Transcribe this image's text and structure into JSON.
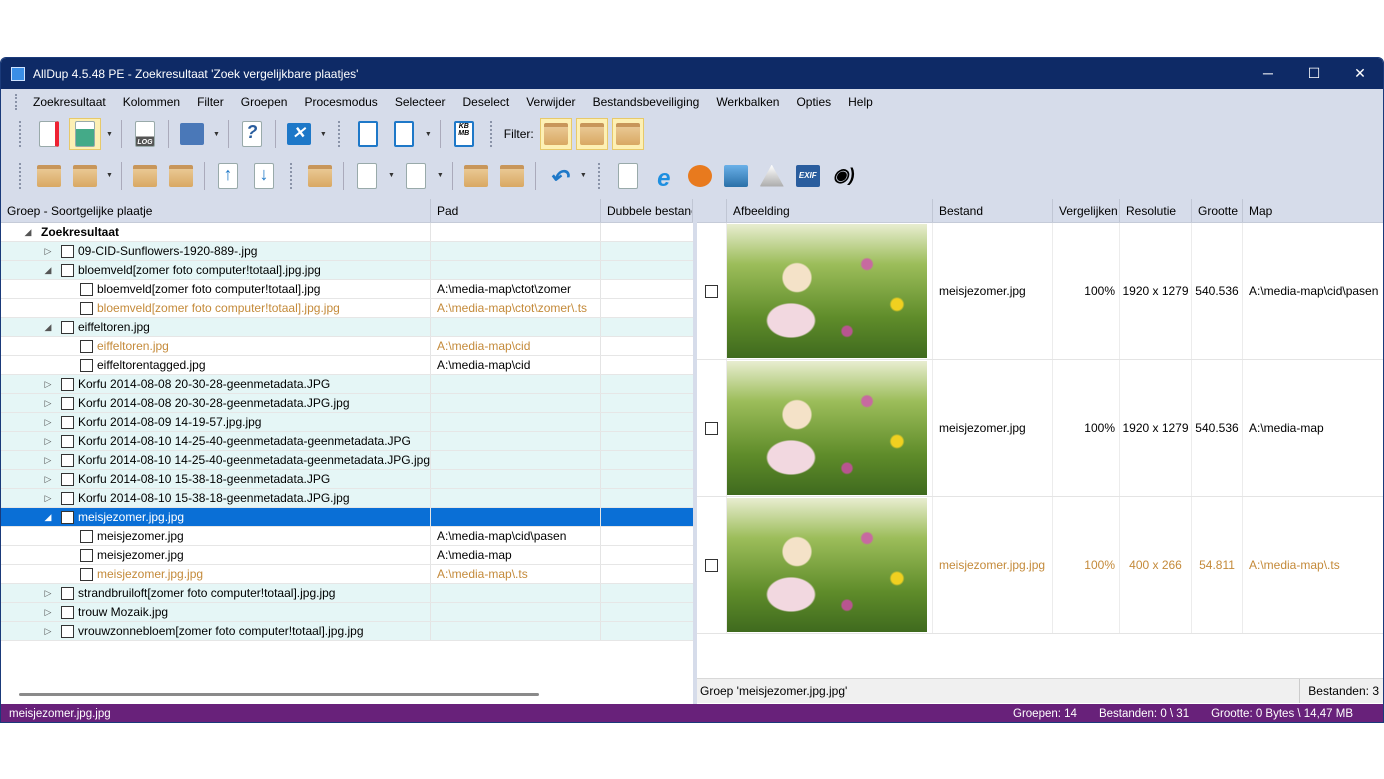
{
  "window": {
    "title": "AllDup 4.5.48 PE - Zoekresultaat 'Zoek vergelijkbare plaatjes'",
    "minimize": "─",
    "maximize": "☐",
    "close": "✕"
  },
  "menu": [
    "Zoekresultaat",
    "Kolommen",
    "Filter",
    "Groepen",
    "Procesmodus",
    "Selecteer",
    "Deselect",
    "Verwijder",
    "Bestandsbeveiliging",
    "Werkbalken",
    "Opties",
    "Help"
  ],
  "toolbar": {
    "filter_label": "Filter:",
    "log_label": "LOG",
    "kbmb_label": "KB MB",
    "exif_label": "EXIF"
  },
  "left": {
    "headers": [
      "Groep - Soortgelijke plaatje",
      "Pad",
      "Dubbele bestanc"
    ],
    "rows": [
      {
        "type": "root",
        "name": "Zoekresultaat",
        "path": ""
      },
      {
        "type": "group",
        "exp": "▷",
        "name": "09-CID-Sunflowers-1920-889-.jpg",
        "path": ""
      },
      {
        "type": "group",
        "exp": "◢",
        "name": "bloemveld[zomer foto computer!totaal].jpg.jpg",
        "path": ""
      },
      {
        "type": "file",
        "name": "bloemveld[zomer foto computer!totaal].jpg",
        "path": "A:\\media-map\\ctot\\zomer"
      },
      {
        "type": "dup",
        "name": "bloemveld[zomer foto computer!totaal].jpg.jpg",
        "path": "A:\\media-map\\ctot\\zomer\\.ts"
      },
      {
        "type": "group",
        "exp": "◢",
        "name": "eiffeltoren.jpg",
        "path": ""
      },
      {
        "type": "dup",
        "name": "eiffeltoren.jpg",
        "path": "A:\\media-map\\cid"
      },
      {
        "type": "file",
        "name": "eiffeltorentagged.jpg",
        "path": "A:\\media-map\\cid"
      },
      {
        "type": "group",
        "exp": "▷",
        "name": "Korfu  2014-08-08 20-30-28-geenmetadata.JPG",
        "path": ""
      },
      {
        "type": "group",
        "exp": "▷",
        "name": "Korfu  2014-08-08 20-30-28-geenmetadata.JPG.jpg",
        "path": ""
      },
      {
        "type": "group",
        "exp": "▷",
        "name": "Korfu  2014-08-09 14-19-57.jpg.jpg",
        "path": ""
      },
      {
        "type": "group",
        "exp": "▷",
        "name": "Korfu  2014-08-10 14-25-40-geenmetadata-geenmetadata.JPG",
        "path": ""
      },
      {
        "type": "group",
        "exp": "▷",
        "name": "Korfu  2014-08-10 14-25-40-geenmetadata-geenmetadata.JPG.jpg",
        "path": ""
      },
      {
        "type": "group",
        "exp": "▷",
        "name": "Korfu  2014-08-10 15-38-18-geenmetadata.JPG",
        "path": ""
      },
      {
        "type": "group",
        "exp": "▷",
        "name": "Korfu  2014-08-10 15-38-18-geenmetadata.JPG.jpg",
        "path": ""
      },
      {
        "type": "sel",
        "exp": "◢",
        "name": "meisjezomer.jpg.jpg",
        "path": ""
      },
      {
        "type": "file",
        "name": "meisjezomer.jpg",
        "path": "A:\\media-map\\cid\\pasen"
      },
      {
        "type": "file",
        "name": "meisjezomer.jpg",
        "path": "A:\\media-map"
      },
      {
        "type": "dup",
        "name": "meisjezomer.jpg.jpg",
        "path": "A:\\media-map\\.ts"
      },
      {
        "type": "group",
        "exp": "▷",
        "name": "strandbruiloft[zomer foto computer!totaal].jpg.jpg",
        "path": ""
      },
      {
        "type": "group",
        "exp": "▷",
        "name": "trouw Mozaik.jpg",
        "path": ""
      },
      {
        "type": "group",
        "exp": "▷",
        "name": "vrouwzonnebloem[zomer foto computer!totaal].jpg.jpg",
        "path": ""
      }
    ]
  },
  "right": {
    "headers": [
      "Afbeelding",
      "Bestand",
      "Vergelijken",
      "Resolutie",
      "Grootte",
      "Map"
    ],
    "rows": [
      {
        "dup": false,
        "file": "meisjezomer.jpg",
        "compare": "100%",
        "res": "1920 x 1279",
        "size": "540.536",
        "map": "A:\\media-map\\cid\\pasen"
      },
      {
        "dup": false,
        "file": "meisjezomer.jpg",
        "compare": "100%",
        "res": "1920 x 1279",
        "size": "540.536",
        "map": "A:\\media-map"
      },
      {
        "dup": true,
        "file": "meisjezomer.jpg.jpg",
        "compare": "100%",
        "res": "400 x 266",
        "size": "54.811",
        "map": "A:\\media-map\\.ts"
      }
    ],
    "group_label": "Groep 'meisjezomer.jpg.jpg'",
    "count_label": "Bestanden: 3"
  },
  "status": {
    "current": "meisjezomer.jpg.jpg",
    "groups": "Groepen: 14",
    "files": "Bestanden: 0 \\ 31",
    "size": "Grootte: 0 Bytes \\ 14,47 MB"
  },
  "colors": {
    "titlebar": "#0e2a66",
    "statusbar": "#68217a",
    "selection": "#0a6fd6",
    "duplicate_text": "#c48a3a",
    "group_row": "#e5f6f6"
  }
}
